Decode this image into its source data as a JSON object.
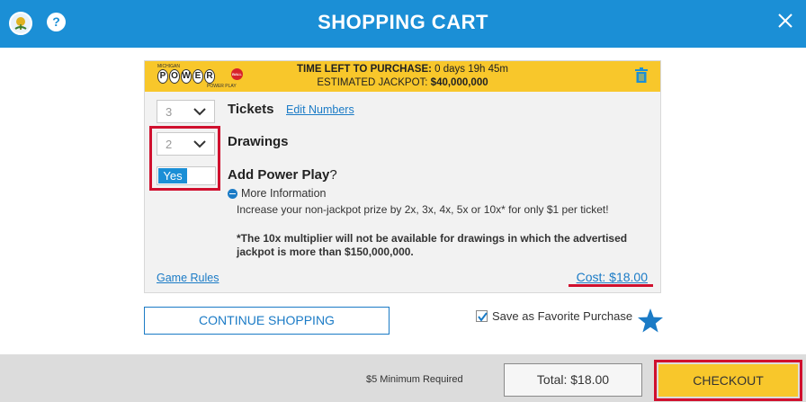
{
  "header": {
    "title": "SHOPPING CART",
    "help_glyph": "?"
  },
  "game": {
    "logo": {
      "state": "MICHIGAN",
      "letters": [
        "P",
        "O",
        "W",
        "E",
        "R"
      ],
      "ball_text": "BALL",
      "sub": "POWER PLAY"
    },
    "time_label": "TIME LEFT TO PURCHASE:",
    "time_value": " 0 days 19h 45m",
    "jackpot_label": "ESTIMATED JACKPOT: ",
    "jackpot_value": "$40,000,000"
  },
  "tickets": {
    "value": "3",
    "label": "Tickets",
    "edit_link": "Edit Numbers"
  },
  "drawings": {
    "value": "2",
    "label": "Drawings"
  },
  "power_play": {
    "toggle_value": "Yes",
    "label": "Add Power Play",
    "label_suffix": "?",
    "more_info": "More Information",
    "description": "Increase your non-jackpot prize by 2x, 3x, 4x, 5x or 10x* for only $1 per ticket!",
    "note": "*The 10x multiplier will not be available for drawings in which the advertised jackpot is more than $150,000,000."
  },
  "game_rules_link": "Game Rules",
  "cost": "Cost: $18.00",
  "actions": {
    "continue_shopping": "CONTINUE SHOPPING",
    "save_favorite": "Save as Favorite Purchase",
    "save_favorite_checked": true
  },
  "footer": {
    "minimum": "$5 Minimum Required",
    "total": "Total: $18.00",
    "checkout": "CHECKOUT"
  },
  "colors": {
    "header": "#1b8fd6",
    "banner": "#f8c72b",
    "highlight": "#d0102e",
    "link": "#1b7bc6"
  }
}
